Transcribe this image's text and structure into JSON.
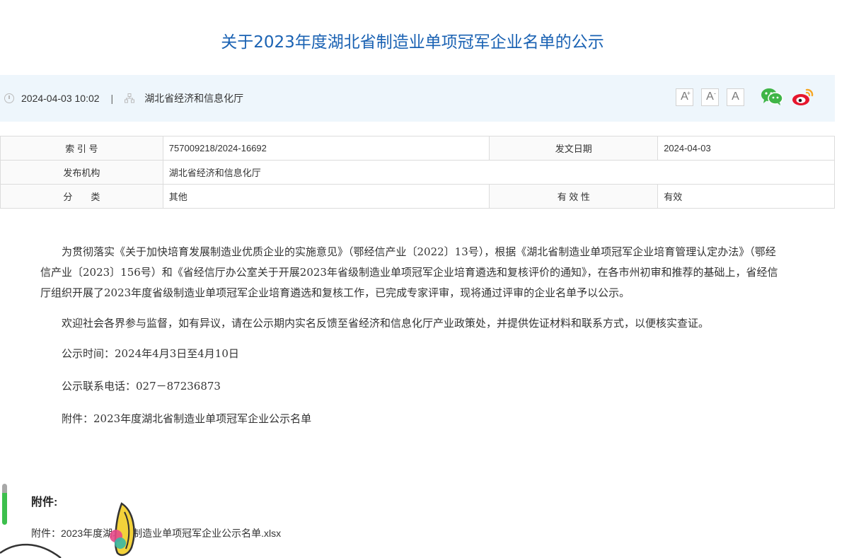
{
  "article": {
    "title": "关于2023年度湖北省制造业单项冠军企业名单的公示",
    "date": "2024-04-03 10:02",
    "separator": "|",
    "source": "湖北省经济和信息化厅"
  },
  "toolbar": {
    "font_large": "A",
    "font_large_mark": "+",
    "font_small": "A",
    "font_small_mark": "-",
    "font_default": "A"
  },
  "info_table": {
    "index_label": "索 引 号",
    "index_value": "757009218/2024-16692",
    "date_label": "发文日期",
    "date_value": "2024-04-03",
    "publisher_label": "发布机构",
    "publisher_value": "湖北省经济和信息化厅",
    "category_label": "分　　类",
    "category_value": "其他",
    "validity_label": "有 效 性",
    "validity_value": "有效"
  },
  "body": {
    "p1": "为贯彻落实《关于加快培育发展制造业优质企业的实施意见》（鄂经信产业〔2022〕13号），根据《湖北省制造业单项冠军企业培育管理认定办法》（鄂经信产业〔2023〕156号）和《省经信厅办公室关于开展2023年省级制造业单项冠军企业培育遴选和复核评价的通知》，在各市州初审和推荐的基础上，省经信厅组织开展了2023年度省级制造业单项冠军企业培育遴选和复核工作，已完成专家评审，现将通过评审的企业名单予以公示。",
    "p2": "欢迎社会各界参与监督，如有异议，请在公示期内实名反馈至省经济和信息化厅产业政策处，并提供佐证材料和联系方式，以便核实查证。",
    "p3": "公示时间：2024年4月3日至4月10日",
    "p4": "公示联系电话：027－87236873",
    "p5": "附件：2023年度湖北省制造业单项冠军企业公示名单"
  },
  "attachments": {
    "heading": "附件:",
    "file_label": "附件：2023年度湖北省制造业单项冠军企业公示名单.xlsx"
  },
  "colors": {
    "title": "#1a62b3",
    "meta_bg": "#eef6fc",
    "wechat": "#3fb547",
    "weibo_red": "#e6162d",
    "weibo_orange": "#f6a623"
  },
  "icons": [
    "clock-icon",
    "organization-icon",
    "wechat-icon",
    "weibo-icon"
  ]
}
